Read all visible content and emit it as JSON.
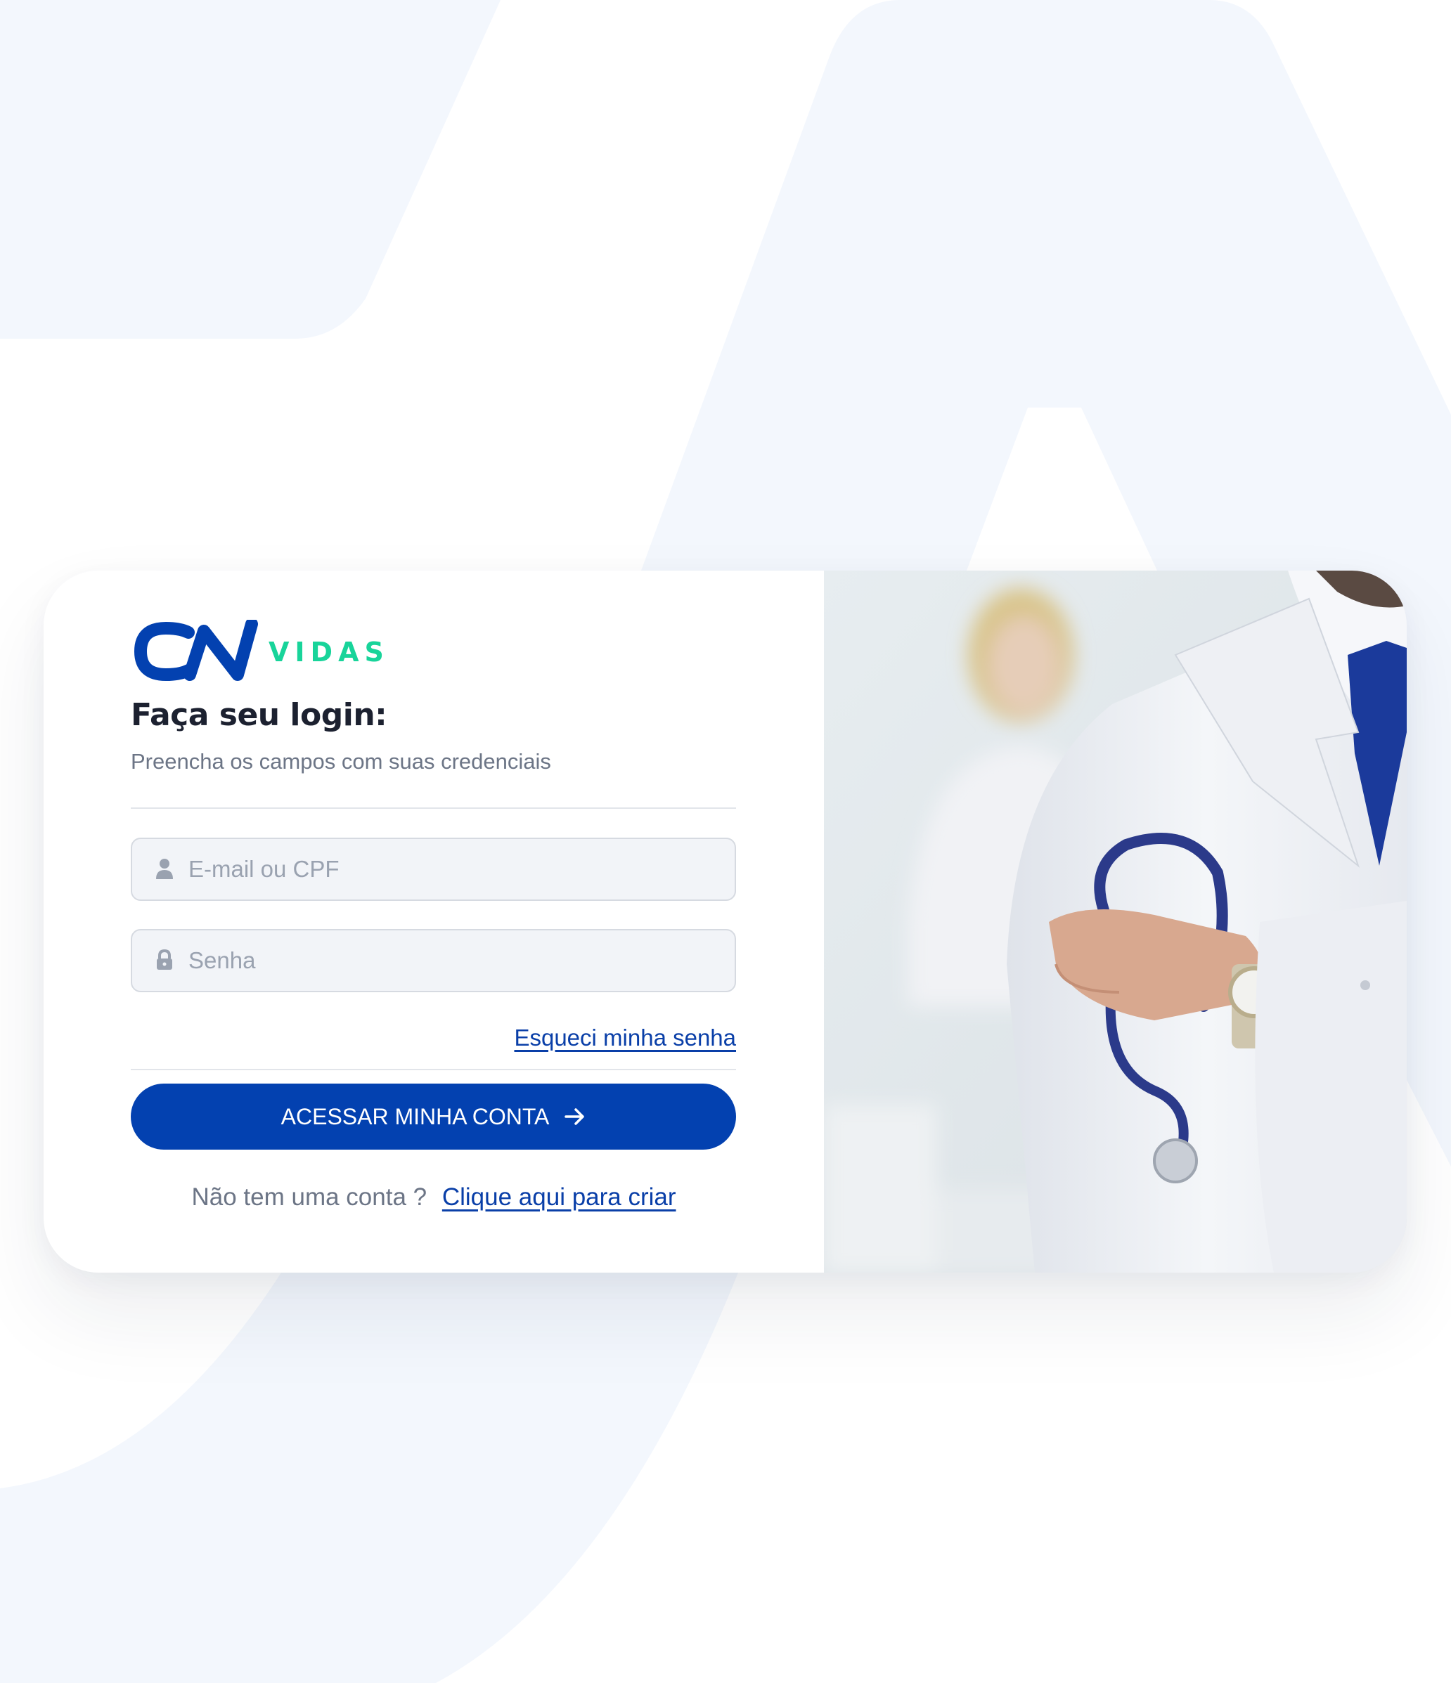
{
  "brand": {
    "logo_text": "VIDAS",
    "logo_mark": "CN",
    "primary_color": "#0341b0",
    "accent_color": "#18d49a"
  },
  "login": {
    "title": "Faça seu login:",
    "subtitle": "Preencha os campos com suas credenciais",
    "email_placeholder": "E-mail ou CPF",
    "email_icon": "user-icon",
    "password_placeholder": "Senha",
    "password_icon": "lock-icon",
    "forgot_label": "Esqueci minha senha",
    "submit_label": "ACESSAR MINHA CONTA",
    "submit_icon": "arrow-right-icon",
    "signup_prompt": "Não tem uma conta ?",
    "signup_link": "Clique aqui para criar"
  },
  "hero": {
    "image": "doctor-with-stethoscope"
  }
}
